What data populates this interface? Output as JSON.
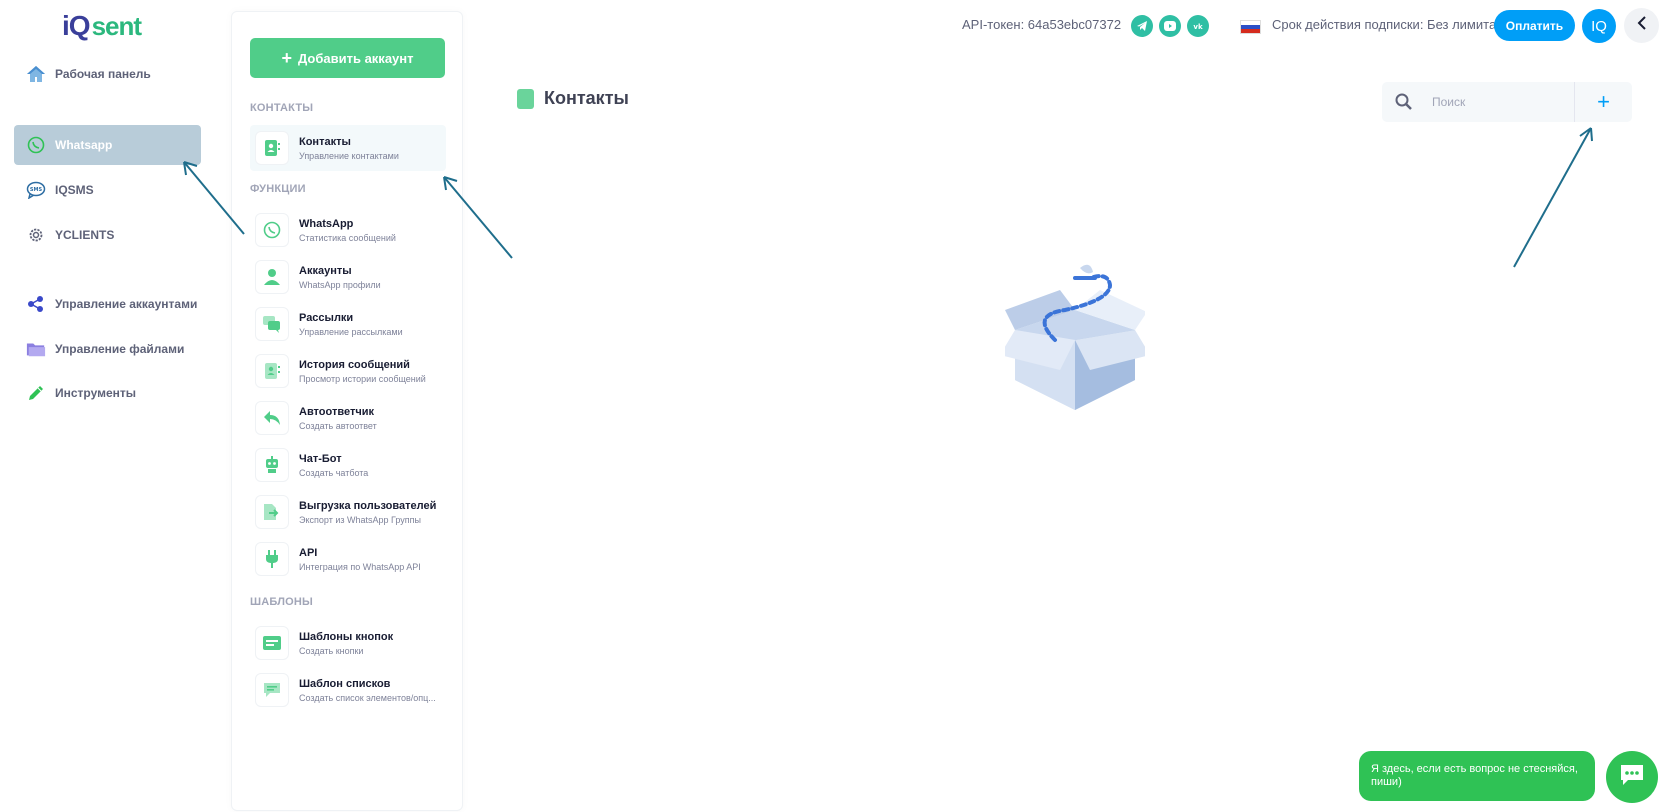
{
  "logo": {
    "iq": "iQ",
    "sent": "sent"
  },
  "sidebar": {
    "items": [
      {
        "label": "Рабочая панель",
        "icon": "home-icon"
      },
      {
        "label": "Whatsapp",
        "icon": "whatsapp-icon",
        "active": true
      },
      {
        "label": "IQSMS",
        "icon": "sms-icon"
      },
      {
        "label": "YCLIENTS",
        "icon": "gear-icon"
      },
      {
        "label": "Управление аккаунтами",
        "icon": "share-icon"
      },
      {
        "label": "Управление файлами",
        "icon": "folder-icon"
      },
      {
        "label": "Инструменты",
        "icon": "pencil-icon"
      }
    ]
  },
  "panel": {
    "add_label": "Добавить аккаунт",
    "sections": [
      {
        "title": "КОНТАКТЫ"
      },
      {
        "title": "ФУНКЦИИ"
      },
      {
        "title": "ШАБЛОНЫ"
      }
    ],
    "items": [
      {
        "title": "Контакты",
        "subtitle": "Управление контактами",
        "icon": "contacts-icon"
      },
      {
        "title": "WhatsApp",
        "subtitle": "Статистика сообщений",
        "icon": "whatsapp-icon"
      },
      {
        "title": "Аккаунты",
        "subtitle": "WhatsApp профили",
        "icon": "user-icon"
      },
      {
        "title": "Рассылки",
        "subtitle": "Управление рассылками",
        "icon": "chat-bubbles-icon"
      },
      {
        "title": "История сообщений",
        "subtitle": "Просмотр истории сообщений",
        "icon": "history-icon"
      },
      {
        "title": "Автоответчик",
        "subtitle": "Создать автоответ",
        "icon": "reply-icon"
      },
      {
        "title": "Чат-Бот",
        "subtitle": "Создать чатбота",
        "icon": "robot-icon"
      },
      {
        "title": "Выгрузка пользователей",
        "subtitle": "Экспорт из WhatsApp Группы",
        "icon": "export-icon"
      },
      {
        "title": "API",
        "subtitle": "Интеграция по WhatsApp API",
        "icon": "plug-icon"
      },
      {
        "title": "Шаблоны кнопок",
        "subtitle": "Создать кнопки",
        "icon": "buttons-template-icon"
      },
      {
        "title": "Шаблон списков",
        "subtitle": "Создать список элементов/опц...",
        "icon": "list-template-icon"
      }
    ]
  },
  "header": {
    "api_token": "API-токен: 64a53ebc07372",
    "socials": [
      "telegram-icon",
      "youtube-icon",
      "vk-icon"
    ],
    "subscription": "Срок действия подписки: Без лимита",
    "pay_label": "Оплатить",
    "avatar": "IQ"
  },
  "main": {
    "title": "Контакты",
    "search_placeholder": "Поиск"
  },
  "chat": {
    "message": "Я здесь, если есть вопрос не стесняйся, пиши)"
  },
  "colors": {
    "accent": "#009ef7",
    "green": "#50cd89",
    "active_sidebar": "#b8ccd9",
    "arrow": "#1f6e8c"
  }
}
